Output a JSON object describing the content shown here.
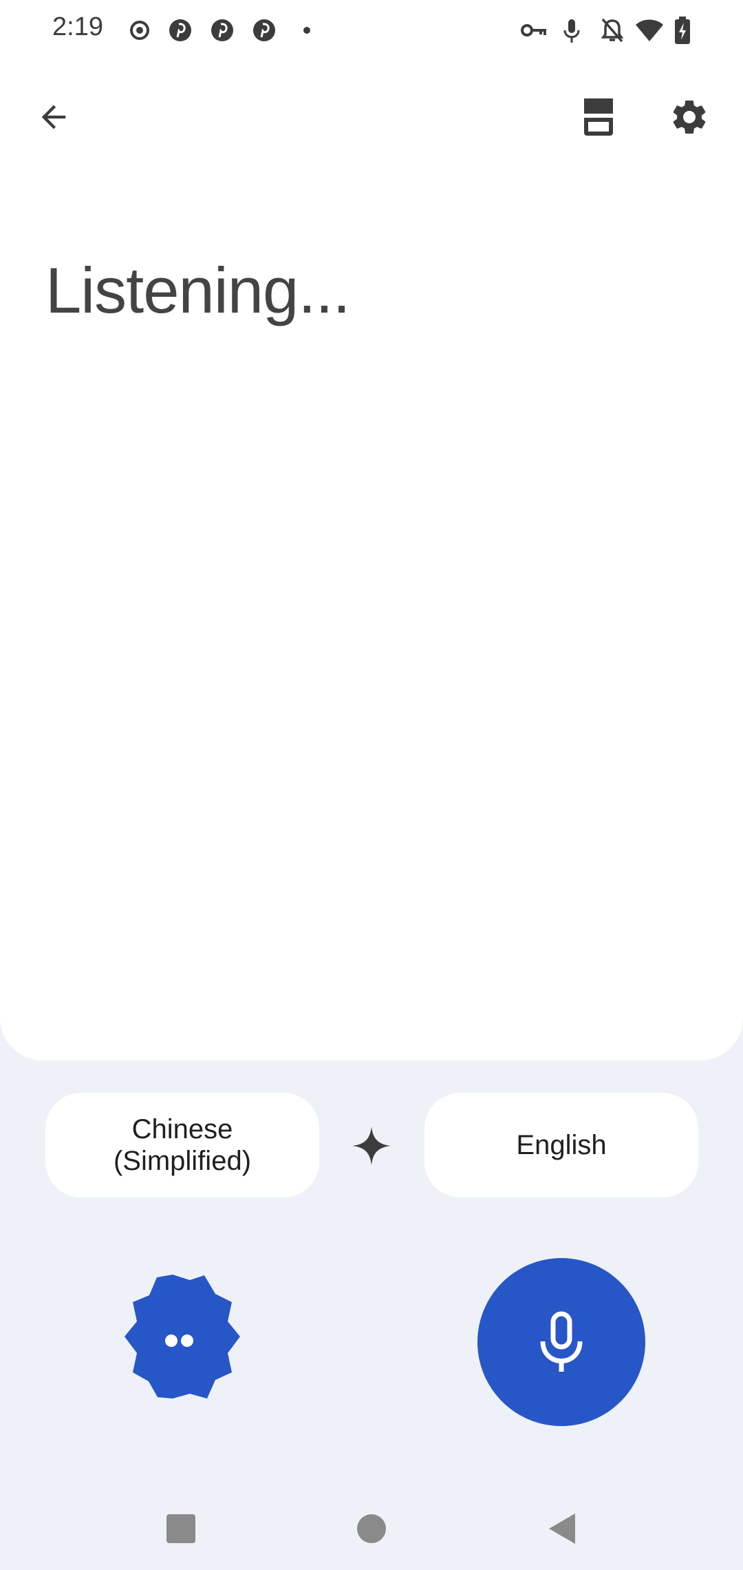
{
  "status_bar": {
    "time": "2:19",
    "left_icons": [
      "record-icon",
      "pinterest-icon",
      "pinterest-icon",
      "pinterest-icon",
      "dot-icon"
    ],
    "right_icons": [
      "vpn-key-icon",
      "mic-icon",
      "notifications-off-icon",
      "wifi-icon",
      "battery-charging-icon"
    ]
  },
  "top_bar": {
    "back_icon": "arrow-back-icon",
    "layout_icon": "split-view-icon",
    "settings_icon": "gear-icon"
  },
  "main": {
    "status_text": "Listening..."
  },
  "languages": {
    "source": "Chinese (Simplified)",
    "target": "English",
    "swap_icon": "sparkle-icon"
  },
  "controls": {
    "auto_icon": "auto-detect-icon",
    "mic_icon": "mic-icon"
  },
  "colors": {
    "accent": "#2756c7",
    "background": "#eef2f8",
    "card": "#ffffff"
  }
}
